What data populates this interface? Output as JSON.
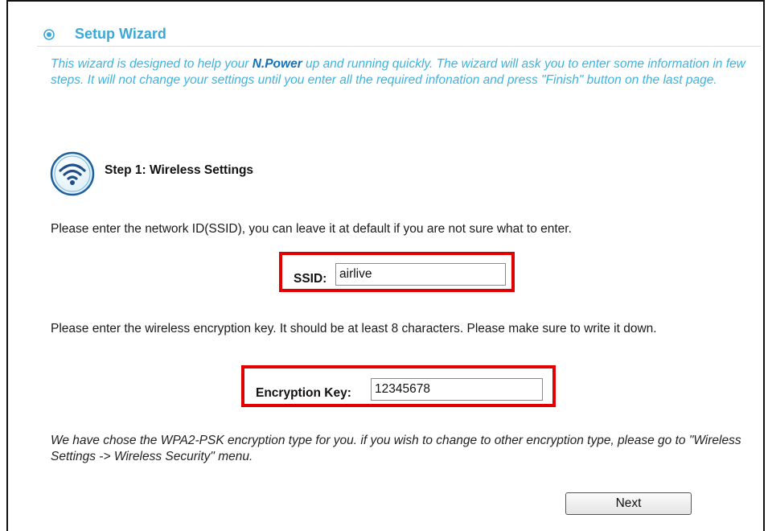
{
  "header": {
    "title": "Setup Wizard",
    "icon": "radio-target-icon",
    "accent_color": "#3aa8d8"
  },
  "intro": {
    "text_before": "This wizard is designed to help your ",
    "brand": "N.Power",
    "text_after": " up and running quickly. The wizard will ask you to enter some information in few steps. It will not change your settings until you enter all the required infonation and press \"Finish\" button on the last page."
  },
  "step": {
    "icon": "wireless-signal-icon",
    "title": "Step 1: Wireless Settings"
  },
  "ssid_instruction": "Please enter the network ID(SSID), you can leave it at default if you are not sure what to enter.",
  "ssid": {
    "label": "SSID:",
    "value": "airlive"
  },
  "key_instruction": "Please enter the wireless encryption key. It should be at least 8 characters. Please make sure to write it down.",
  "encryption_key": {
    "label": "Encryption Key:",
    "value": "12345678"
  },
  "note": "We have chose the WPA2-PSK encryption type for you.  if you wish to change to other encryption type, please go to \"Wireless Settings -> Wireless Security\" menu.",
  "next_button": "Next",
  "highlight_color": "#e00000"
}
